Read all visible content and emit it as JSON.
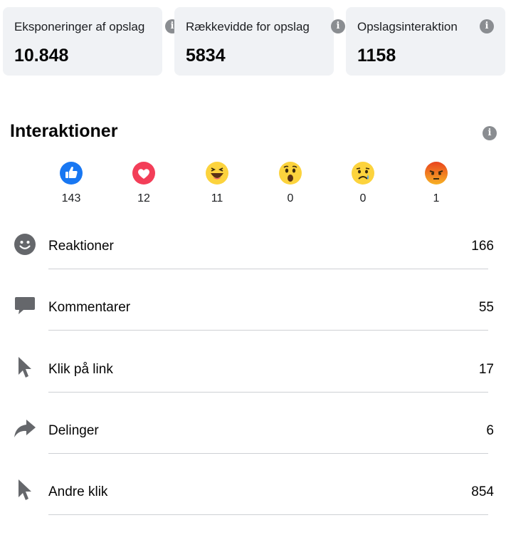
{
  "cards": [
    {
      "label": "Eksponeringer af opslag",
      "value": "10.848"
    },
    {
      "label": "Rækkevidde for opslag",
      "value": "5834"
    },
    {
      "label": "Opslagsinteraktion",
      "value": "1158"
    }
  ],
  "interactions": {
    "title": "Interaktioner",
    "reactions": [
      {
        "icon": "like-icon",
        "count": "143"
      },
      {
        "icon": "love-icon",
        "count": "12"
      },
      {
        "icon": "haha-icon",
        "count": "11"
      },
      {
        "icon": "wow-icon",
        "count": "0"
      },
      {
        "icon": "sad-icon",
        "count": "0"
      },
      {
        "icon": "angry-icon",
        "count": "1"
      }
    ],
    "rows": [
      {
        "icon": "smiley-icon",
        "label": "Reaktioner",
        "value": "166"
      },
      {
        "icon": "comment-icon",
        "label": "Kommentarer",
        "value": "55"
      },
      {
        "icon": "cursor-icon",
        "label": "Klik på link",
        "value": "17"
      },
      {
        "icon": "share-icon",
        "label": "Delinger",
        "value": "6"
      },
      {
        "icon": "cursor-icon",
        "label": "Andre klik",
        "value": "854"
      }
    ]
  },
  "colors": {
    "card_bg": "#f0f2f5",
    "info_icon": "#8a8d91",
    "like_blue": "#1877f2",
    "love_red": "#f33e58",
    "emoji_yellow": "#fcd33d",
    "angry_orange": "#f0622b",
    "row_icon": "#65676b"
  }
}
